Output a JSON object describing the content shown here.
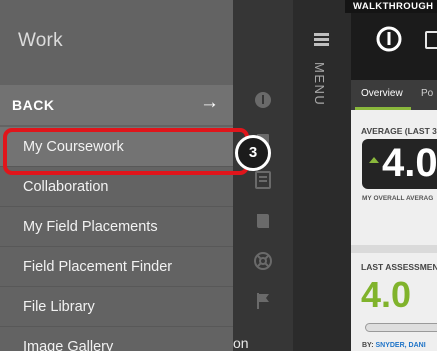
{
  "drawer": {
    "title": "Work",
    "back_label": "BACK",
    "back_arrow": "→",
    "items": [
      {
        "label": "My Coursework",
        "active": true
      },
      {
        "label": "Collaboration"
      },
      {
        "label": "My Field Placements"
      },
      {
        "label": "Field Placement Finder"
      },
      {
        "label": "File Library"
      },
      {
        "label": "Image Gallery"
      }
    ]
  },
  "walkthrough": {
    "step": "3",
    "banner": "WALKTHROUGH",
    "highlight_color": "#e0151b"
  },
  "side_icons": [
    "logo-icon",
    "document-icon",
    "notebook-icon",
    "book-icon",
    "lifebuoy-icon",
    "flag-icon"
  ],
  "partial_text": "on",
  "menu_column": {
    "label": "MENU"
  },
  "app": {
    "tabs": [
      "Overview",
      "Po"
    ],
    "average_label": "AVERAGE (LAST 3",
    "average_value": "4.0",
    "average_sub": "MY OVERALL AVERAG",
    "last_label": "LAST ASSESSMEN",
    "last_value": "4.0",
    "by_prefix": "BY: ",
    "by_name": "SNYDER, DANI",
    "accent": "#80b32c"
  }
}
